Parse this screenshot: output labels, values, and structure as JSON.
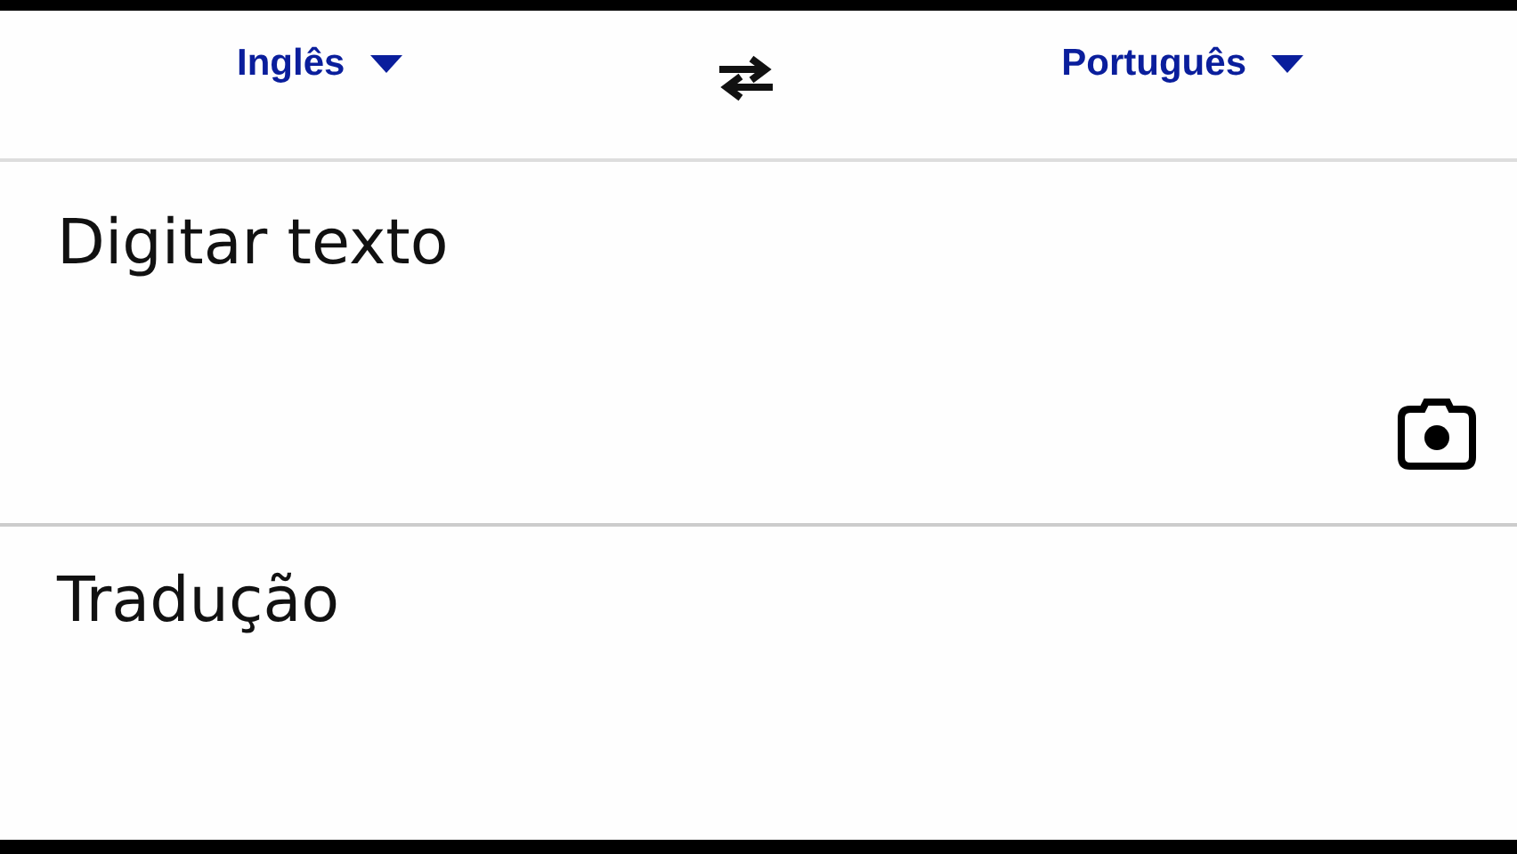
{
  "languages": {
    "source": "Inglês",
    "target": "Português"
  },
  "input": {
    "placeholder": "Digitar texto"
  },
  "output": {
    "placeholder": "Tradução"
  }
}
